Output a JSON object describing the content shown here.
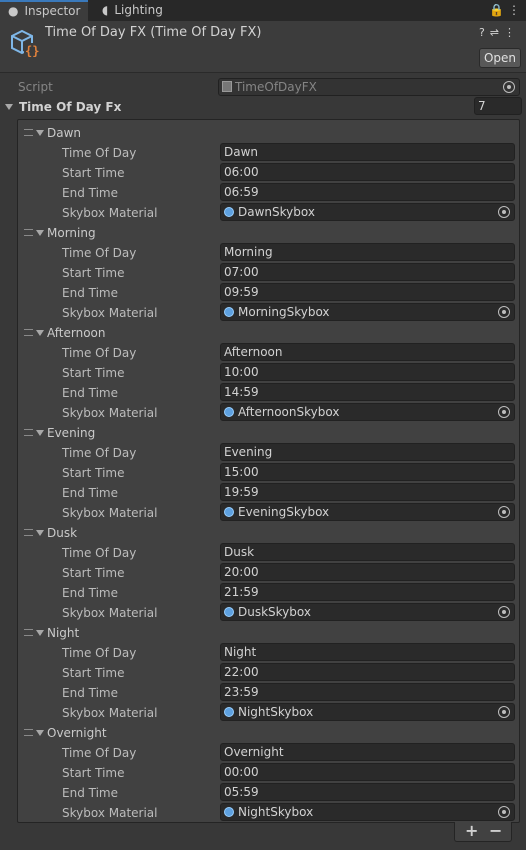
{
  "tabs": [
    {
      "label": "Inspector",
      "icon": "info-icon"
    },
    {
      "label": "Lighting",
      "icon": "lightbulb-icon"
    }
  ],
  "header": {
    "title": "Time Of Day FX (Time Of Day FX)",
    "open_label": "Open"
  },
  "script": {
    "label": "Script",
    "value": "TimeOfDayFX"
  },
  "list": {
    "label": "Time Of Day Fx",
    "count": "7",
    "property_labels": {
      "time_of_day": "Time Of Day",
      "start_time": "Start Time",
      "end_time": "End Time",
      "skybox_material": "Skybox Material"
    },
    "elements": [
      {
        "name": "Dawn",
        "time_of_day": "Dawn",
        "start_time": "06:00",
        "end_time": "06:59",
        "skybox": "DawnSkybox"
      },
      {
        "name": "Morning",
        "time_of_day": "Morning",
        "start_time": "07:00",
        "end_time": "09:59",
        "skybox": "MorningSkybox"
      },
      {
        "name": "Afternoon",
        "time_of_day": "Afternoon",
        "start_time": "10:00",
        "end_time": "14:59",
        "skybox": "AfternoonSkybox"
      },
      {
        "name": "Evening",
        "time_of_day": "Evening",
        "start_time": "15:00",
        "end_time": "19:59",
        "skybox": "EveningSkybox"
      },
      {
        "name": "Dusk",
        "time_of_day": "Dusk",
        "start_time": "20:00",
        "end_time": "21:59",
        "skybox": "DuskSkybox"
      },
      {
        "name": "Night",
        "time_of_day": "Night",
        "start_time": "22:00",
        "end_time": "23:59",
        "skybox": "NightSkybox"
      },
      {
        "name": "Overnight",
        "time_of_day": "Overnight",
        "start_time": "00:00",
        "end_time": "05:59",
        "skybox": "NightSkybox"
      }
    ],
    "add_label": "+",
    "remove_label": "−"
  },
  "colors": {
    "background": "#383838",
    "field": "#2a2a2a",
    "accent": "#3a79bb"
  }
}
